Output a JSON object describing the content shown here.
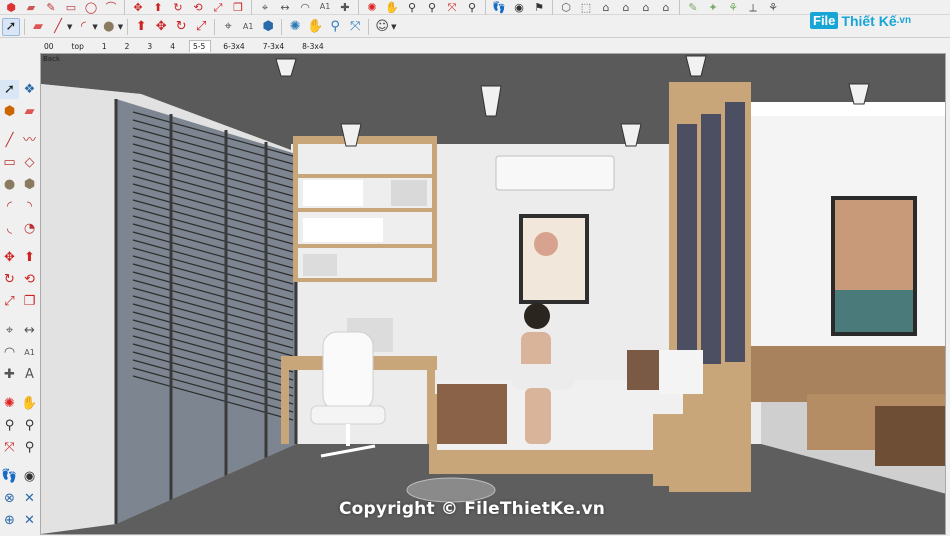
{
  "toolbar_top": {
    "icons": [
      "paint-icon",
      "eraser-icon",
      "pencil-icon",
      "rect-icon",
      "circle-icon",
      "arc-icon",
      "tape-icon",
      "move-icon",
      "rotate-icon",
      "offset-icon",
      "pushpull-icon",
      "followme-icon",
      "scale-icon",
      "tape2-icon",
      "protractor-icon",
      "axes-icon",
      "text-icon",
      "dim-icon",
      "section-icon",
      "orbit-icon",
      "pan-icon",
      "zoom-icon",
      "zoomwin-icon",
      "zoomext-icon",
      "prev-icon",
      "iso-icon",
      "top-icon",
      "front-icon",
      "right-icon",
      "back-icon",
      "left-icon",
      "xray-icon",
      "wire-icon",
      "hidden-icon",
      "shaded-icon",
      "texture-icon",
      "mono-icon",
      "walk-icon",
      "look-icon",
      "position-icon",
      "sandbox-icon",
      "stamp-icon",
      "drape-icon"
    ]
  },
  "toolbar_main": {
    "icons": [
      "select-icon",
      "eraser-icon",
      "line-icon",
      "arc-icon",
      "shape-icon",
      "pushpull-icon",
      "move-icon",
      "rotate-icon",
      "scale-icon",
      "tape-icon",
      "text-icon",
      "paint-icon",
      "orbit-icon",
      "pan-icon",
      "zoom-icon",
      "zoom-extents-icon",
      "component-icon",
      "material-icon",
      "styles-icon",
      "user-icon"
    ]
  },
  "scenes": {
    "tabs": [
      "00",
      "top",
      "1",
      "2",
      "3",
      "4",
      "5-5",
      "6-3x4",
      "7-3x4",
      "8-3x4"
    ],
    "active_index": 6
  },
  "viewport": {
    "label": "Back",
    "watermark": "Copyright © FileThietKe.vn"
  },
  "logo": {
    "tag": "File",
    "name": "Thiết Kế",
    "suffix": ".vn"
  },
  "colors": {
    "ceiling": "#5a5a5a",
    "wall": "#ececec",
    "floor": "#5e5e5e",
    "wood": "#c9a57a",
    "sofa": "#a8825c",
    "logo_blue": "#17a5d6"
  }
}
